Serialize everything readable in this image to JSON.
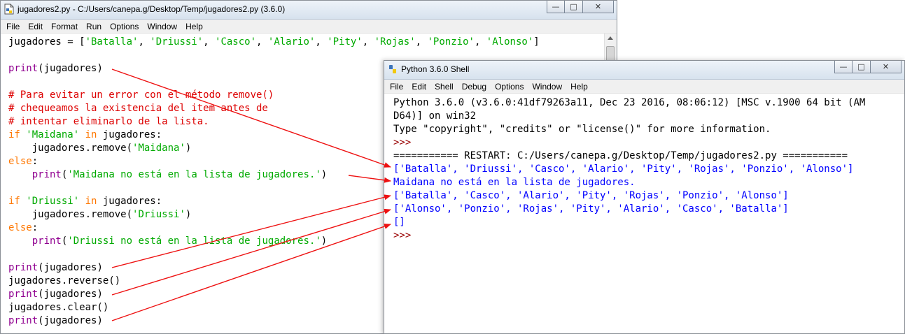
{
  "editor": {
    "title": "jugadores2.py - C:/Users/canepa.g/Desktop/Temp/jugadores2.py (3.6.0)",
    "menu": [
      "File",
      "Edit",
      "Format",
      "Run",
      "Options",
      "Window",
      "Help"
    ],
    "lines": [
      [
        [
          "n",
          "jugadores = ["
        ],
        [
          "s",
          "'Batalla'"
        ],
        [
          "n",
          ", "
        ],
        [
          "s",
          "'Driussi'"
        ],
        [
          "n",
          ", "
        ],
        [
          "s",
          "'Casco'"
        ],
        [
          "n",
          ", "
        ],
        [
          "s",
          "'Alario'"
        ],
        [
          "n",
          ", "
        ],
        [
          "s",
          "'Pity'"
        ],
        [
          "n",
          ", "
        ],
        [
          "s",
          "'Rojas'"
        ],
        [
          "n",
          ", "
        ],
        [
          "s",
          "'Ponzio'"
        ],
        [
          "n",
          ", "
        ],
        [
          "s",
          "'Alonso'"
        ],
        [
          "n",
          "]"
        ]
      ],
      [],
      [
        [
          "b",
          "print"
        ],
        [
          "n",
          "(jugadores)"
        ]
      ],
      [],
      [
        [
          "c",
          "# Para evitar un error con el método remove()"
        ]
      ],
      [
        [
          "c",
          "# chequeamos la existencia del item antes de"
        ]
      ],
      [
        [
          "c",
          "# intentar eliminarlo de la lista."
        ]
      ],
      [
        [
          "k",
          "if"
        ],
        [
          "n",
          " "
        ],
        [
          "s",
          "'Maidana'"
        ],
        [
          "n",
          " "
        ],
        [
          "k",
          "in"
        ],
        [
          "n",
          " jugadores:"
        ]
      ],
      [
        [
          "n",
          "    jugadores.remove("
        ],
        [
          "s",
          "'Maidana'"
        ],
        [
          "n",
          ")"
        ]
      ],
      [
        [
          "k",
          "else"
        ],
        [
          "n",
          ":"
        ]
      ],
      [
        [
          "n",
          "    "
        ],
        [
          "b",
          "print"
        ],
        [
          "n",
          "("
        ],
        [
          "s",
          "'Maidana no está en la lista de jugadores.'"
        ],
        [
          "n",
          ")"
        ]
      ],
      [],
      [
        [
          "k",
          "if"
        ],
        [
          "n",
          " "
        ],
        [
          "s",
          "'Driussi'"
        ],
        [
          "n",
          " "
        ],
        [
          "k",
          "in"
        ],
        [
          "n",
          " jugadores:"
        ]
      ],
      [
        [
          "n",
          "    jugadores.remove("
        ],
        [
          "s",
          "'Driussi'"
        ],
        [
          "n",
          ")"
        ]
      ],
      [
        [
          "k",
          "else"
        ],
        [
          "n",
          ":"
        ]
      ],
      [
        [
          "n",
          "    "
        ],
        [
          "b",
          "print"
        ],
        [
          "n",
          "("
        ],
        [
          "s",
          "'Driussi no está en la lista de jugadores.'"
        ],
        [
          "n",
          ")"
        ]
      ],
      [],
      [
        [
          "b",
          "print"
        ],
        [
          "n",
          "(jugadores)"
        ]
      ],
      [
        [
          "n",
          "jugadores.reverse()"
        ]
      ],
      [
        [
          "b",
          "print"
        ],
        [
          "n",
          "(jugadores)"
        ]
      ],
      [
        [
          "n",
          "jugadores.clear()"
        ]
      ],
      [
        [
          "b",
          "print"
        ],
        [
          "n",
          "(jugadores)"
        ]
      ]
    ]
  },
  "shell": {
    "title": "Python 3.6.0 Shell",
    "menu": [
      "File",
      "Edit",
      "Shell",
      "Debug",
      "Options",
      "Window",
      "Help"
    ],
    "lines": [
      [
        [
          "n",
          "Python 3.6.0 (v3.6.0:41df79263a11, Dec 23 2016, 08:06:12) [MSC v.1900 64 bit (AM"
        ]
      ],
      [
        [
          "n",
          "D64)] on win32"
        ]
      ],
      [
        [
          "n",
          "Type \"copyright\", \"credits\" or \"license()\" for more information."
        ]
      ],
      [
        [
          "p",
          ">>> "
        ]
      ],
      [
        [
          "n",
          "=========== RESTART: C:/Users/canepa.g/Desktop/Temp/jugadores2.py ==========="
        ]
      ],
      [
        [
          "o",
          "['Batalla', 'Driussi', 'Casco', 'Alario', 'Pity', 'Rojas', 'Ponzio', 'Alonso']"
        ]
      ],
      [
        [
          "o",
          "Maidana no está en la lista de jugadores."
        ]
      ],
      [
        [
          "o",
          "['Batalla', 'Casco', 'Alario', 'Pity', 'Rojas', 'Ponzio', 'Alonso']"
        ]
      ],
      [
        [
          "o",
          "['Alonso', 'Ponzio', 'Rojas', 'Pity', 'Alario', 'Casco', 'Batalla']"
        ]
      ],
      [
        [
          "o",
          "[]"
        ]
      ],
      [
        [
          "p",
          ">>> "
        ]
      ]
    ]
  },
  "colors": {
    "keyword": "#ff7700",
    "builtin": "#900090",
    "string": "#00aa00",
    "comment": "#dd0000",
    "output": "#0000ff",
    "prompt": "#990000",
    "annotation_arrow": "#ee1111"
  },
  "icons": {
    "app": "idle-python-file-icon",
    "minimize": "minimize-icon",
    "maximize": "maximize-icon",
    "close": "close-icon"
  }
}
